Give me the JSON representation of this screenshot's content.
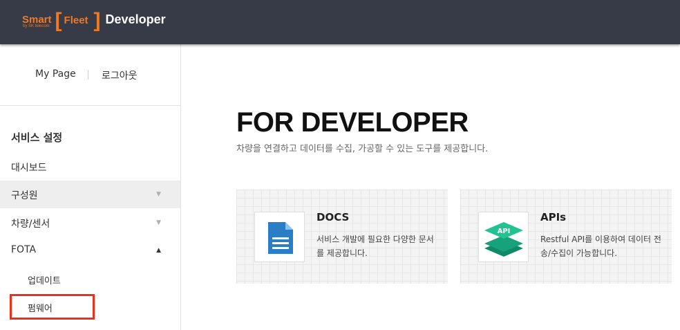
{
  "header": {
    "logo_smart": "Smart",
    "logo_subtext": "by SK telecom",
    "logo_fleet": "Fleet",
    "logo_bracket_open": "[",
    "logo_bracket_close": "]",
    "logo_developer": "Developer"
  },
  "account": {
    "my_page": "My Page",
    "logout": "로그아웃"
  },
  "sidebar": {
    "section_title": "서비스 설정",
    "items": [
      {
        "label": "대시보드"
      },
      {
        "label": "구성원",
        "arrow": "▼"
      },
      {
        "label": "차량/센서",
        "arrow": "▼"
      },
      {
        "label": "FOTA",
        "arrow": "▲"
      }
    ],
    "sub_items": [
      {
        "label": "업데이트"
      },
      {
        "label": "펌웨어"
      }
    ]
  },
  "hero": {
    "title": "FOR DEVELOPER",
    "subtitle": "차량을 연결하고 데이터를 수집, 가공할 수 있는 도구를 제공합니다."
  },
  "cards": [
    {
      "title": "DOCS",
      "description": "서비스 개발에 필요한 다양한 문서를 제공합니다.",
      "icon": "document-icon"
    },
    {
      "title": "APIs",
      "description": "Restful API를 이용하여 데이터 전송/수집이 가능합니다.",
      "icon": "api-layers-icon",
      "icon_text": "API"
    }
  ],
  "colors": {
    "header_bg": "#373a47",
    "brand_orange": "#f07a22",
    "highlight_red": "#e8321f",
    "docs_blue": "#2b7dc5",
    "api_green": "#1fb48a"
  }
}
